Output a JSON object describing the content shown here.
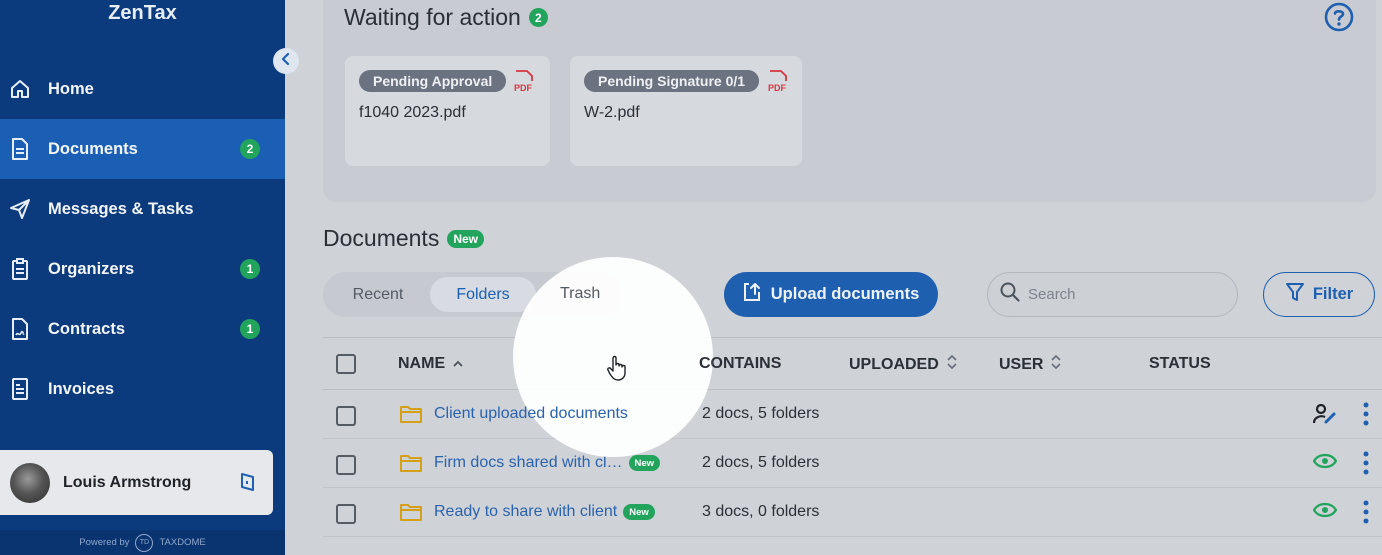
{
  "sidebar": {
    "brand": "ZenTax",
    "items": [
      {
        "label": "Home",
        "icon": "home-icon",
        "badge": ""
      },
      {
        "label": "Documents",
        "icon": "document-icon",
        "badge": "2"
      },
      {
        "label": "Messages & Tasks",
        "icon": "send-icon",
        "badge": ""
      },
      {
        "label": "Organizers",
        "icon": "clipboard-icon",
        "badge": "1"
      },
      {
        "label": "Contracts",
        "icon": "contract-icon",
        "badge": "1"
      },
      {
        "label": "Invoices",
        "icon": "invoice-icon",
        "badge": ""
      }
    ],
    "user": {
      "name": "Louis Armstrong"
    },
    "powered_by": "Powered by",
    "powered_brand": "TAXDOME",
    "powered_mark": "TD"
  },
  "waiting": {
    "title": "Waiting for action",
    "count": "2",
    "cards": [
      {
        "status": "Pending Approval",
        "name": "f1040 2023.pdf",
        "type_label": "PDF"
      },
      {
        "status": "Pending Signature 0/1",
        "name": "W-2.pdf",
        "type_label": "PDF"
      }
    ]
  },
  "documents": {
    "title": "Documents",
    "new_label": "New",
    "tabs": [
      "Recent",
      "Folders",
      "Trash"
    ],
    "active_tab": "Folders",
    "upload_label": "Upload documents",
    "search_placeholder": "Search",
    "filter_label": "Filter",
    "columns": [
      "NAME",
      "CONTAINS",
      "UPLOADED",
      "USER",
      "STATUS"
    ],
    "rows": [
      {
        "name": "Client uploaded documents",
        "new": "",
        "contains": "2 docs, 5 folders",
        "action_icon": "user-edit-icon"
      },
      {
        "name": "Firm docs shared with cl…",
        "new": "New",
        "contains": "2 docs, 5 folders",
        "action_icon": "eye-icon"
      },
      {
        "name": "Ready to share with client",
        "new": "New",
        "contains": "3 docs, 0 folders",
        "action_icon": "eye-icon"
      }
    ]
  },
  "colors": {
    "sidebar": "#0b3a7d",
    "active_nav": "#1a5fb4",
    "badge_green": "#22a45d",
    "primary": "#1f5fb0",
    "pdf_red": "#d9363e",
    "folder": "#d4a017"
  }
}
